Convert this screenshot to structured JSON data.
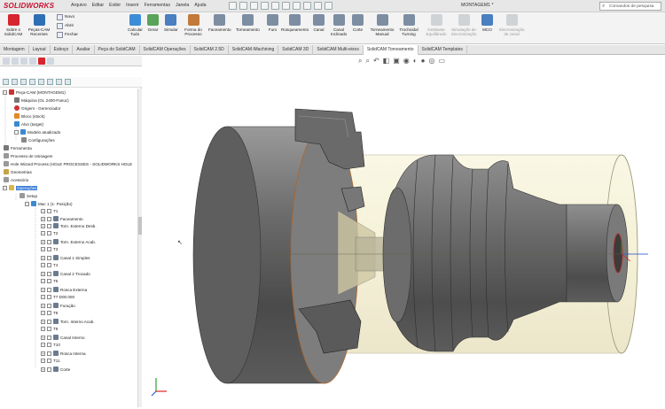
{
  "app": {
    "logo": "SOLIDWORKS",
    "doc_title": "MONTAGEM1 *"
  },
  "menu": [
    "Arquivo",
    "Editar",
    "Exibir",
    "Inserir",
    "Ferramentas",
    "Janela",
    "Ajuda"
  ],
  "search": {
    "placeholder": "Comandos de pesquisa"
  },
  "ribbon": {
    "sobre": "Sobre o SolidCAM",
    "pecas": "Peças-CAM Recentes",
    "novo": "Novo",
    "abrir": "Abrir",
    "fechar": "Fechar",
    "calcular": "Calcular Tudo",
    "gerar": "Gerar",
    "simular": "Simular",
    "forma": "Forma do Processo",
    "faceamento": "Faceamento",
    "torneamento": "Torneamento",
    "furo": "Furo",
    "rosqueamento": "Rosqueamento",
    "canal": "Canal",
    "canal_incl": "Canal Inclinado",
    "corte": "Corte",
    "torn_manual": "Torneamento Manual",
    "trochoidal": "Trochoidal Turning",
    "desbaste": "Desbaste Equilibrado",
    "sincron": "Simulação de Sincronização",
    "mco": "MCO",
    "sincron2": "Sincronização de canal"
  },
  "tabs": [
    "Montagem",
    "Layout",
    "Esboço",
    "Avaliar",
    "Peça do SolidCAM",
    "SolidCAM Operações",
    "SolidCAM 2.5D",
    "SolidCAM iMachining",
    "SolidCAM 3D",
    "SolidCAM Multi-eixos",
    "SolidCAM Torneamento",
    "SolidCAM Templates"
  ],
  "tree": {
    "root": "Peça-CAM (MONTAGEM1)",
    "maquina": "Máquina (GL 2400-Fanuc)",
    "origem": "Origem - Gerenciador",
    "bloco": "Bloco (stock)",
    "alvo": "Alvo (target)",
    "modelo": "Modelo atualizado",
    "config": "Configurações",
    "ferramenta": "Ferramenta",
    "processo": "Processo de Usinagem",
    "hole": "Hole Wizard Process (HOLE PROCESSES - SOLIDWORKS HOLE",
    "geometrias": "Geometrias",
    "acessorio": "Acessório",
    "operacoes": "Operações",
    "setup": "Setup",
    "mac": "Mac 1 (1- Posição)",
    "t1": "T1",
    "op1": "Faceamento",
    "op2": "Torn. Externo Desb.",
    "t2": "T2",
    "op3": "Torn. Externo Acab.",
    "t3": "T3",
    "op4": "Canal 1 Simples",
    "t4": "T4",
    "op5": "Canal 2 Trocado",
    "t5": "T5",
    "op6": "Rosca Externa",
    "t7": "T7 D00.000",
    "op7": "Furação",
    "t8": "T8",
    "op8": "Torn. Interno Acab.",
    "t9": "T9",
    "op9": "Canal Interno",
    "t10": "T10",
    "op10": "Rosca Interna",
    "t11": "T11",
    "op11": "Corte"
  }
}
